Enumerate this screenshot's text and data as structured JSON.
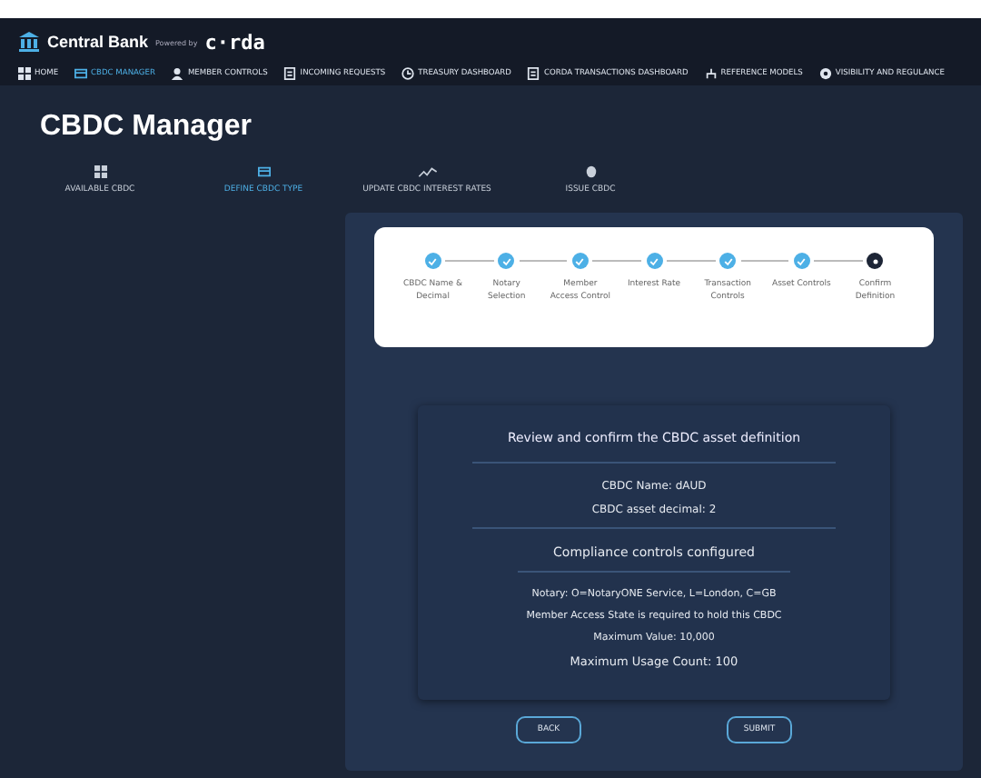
{
  "header": {
    "brand": "Central Bank",
    "powered_by": "Powered by",
    "logo_text": "c·rda"
  },
  "nav": [
    {
      "label": "HOME",
      "selected": false
    },
    {
      "label": "CBDC MANAGER",
      "selected": true
    },
    {
      "label": "MEMBER CONTROLS",
      "selected": false
    },
    {
      "label": "INCOMING REQUESTS",
      "selected": false
    },
    {
      "label": "TREASURY DASHBOARD",
      "selected": false
    },
    {
      "label": "CORDA TRANSACTIONS DASHBOARD",
      "selected": false
    },
    {
      "label": "REFERENCE MODELS",
      "selected": false
    },
    {
      "label": "VISIBILITY AND REGULANCE",
      "selected": false
    }
  ],
  "page_title": "CBDC Manager",
  "tabs": [
    {
      "label": "AVAILABLE CBDC",
      "selected": false
    },
    {
      "label": "DEFINE CBDC TYPE",
      "selected": true
    },
    {
      "label": "UPDATE CBDC INTEREST RATES",
      "selected": false
    },
    {
      "label": "ISSUE CBDC",
      "selected": false
    }
  ],
  "steps": [
    {
      "label": "CBDC Name & Decimal",
      "completed": true
    },
    {
      "label": "Notary Selection",
      "completed": true
    },
    {
      "label": "Member Access Control",
      "completed": true
    },
    {
      "label": "Interest Rate",
      "completed": true
    },
    {
      "label": "Transaction Controls",
      "completed": true
    },
    {
      "label": "Asset Controls",
      "completed": true
    },
    {
      "label": "Confirm Definition",
      "completed": false
    }
  ],
  "review": {
    "title": "Review and confirm the CBDC asset definition",
    "asset_lines": [
      "CBDC Name: dAUD",
      "CBDC asset decimal: 2"
    ],
    "compliance_title": "Compliance controls configured",
    "compliance_lines": [
      "Notary: O=NotaryONE Service, L=London, C=GB",
      "Member Access State is required to hold this CBDC",
      "Maximum Value: 10,000",
      "Maximum Usage Count: 100"
    ]
  },
  "buttons": [
    "BACK",
    "SUBMIT"
  ]
}
